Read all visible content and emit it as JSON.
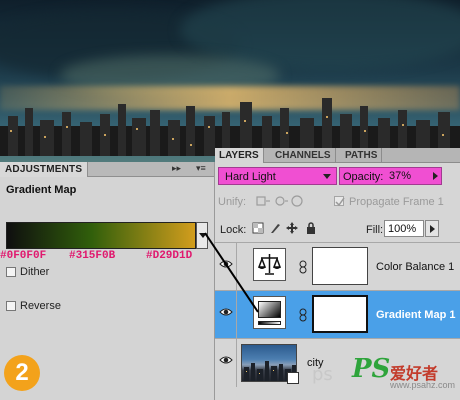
{
  "adjustments": {
    "tab_label": "ADJUSTMENTS",
    "panel_title": "Gradient Map",
    "gradient_colors": [
      "#0F0F0F",
      "#315F0B",
      "#D29D1D"
    ],
    "stop_labels": [
      "#0F0F0F",
      "#315F0B",
      "#D29D1D"
    ],
    "dither_label": "Dither",
    "reverse_label": "Reverse",
    "step_number": "2"
  },
  "layers": {
    "tabs": [
      {
        "label": "LAYERS"
      },
      {
        "label": "CHANNELS"
      },
      {
        "label": "PATHS"
      }
    ],
    "blend_mode": "Hard Light",
    "opacity_label": "Opacity:",
    "opacity_value": "37%",
    "unify_label": "Unify:",
    "propagate_label": "Propagate Frame 1",
    "lock_label": "Lock:",
    "fill_label": "Fill:",
    "fill_value": "100%",
    "rows": [
      {
        "name": "Color Balance 1",
        "selected": false
      },
      {
        "name": "Gradient Map 1",
        "selected": true
      },
      {
        "name": "city",
        "selected": false
      }
    ]
  },
  "watermark": {
    "left_text": "ps",
    "brand": "PS",
    "chinese": "爱好者",
    "url": "www.psahz.com"
  },
  "colors": {
    "highlight_magenta": "#F04FD2",
    "selection_blue": "#4AA0E8",
    "label_pink": "#E0186E",
    "badge_orange": "#F3A21B"
  }
}
